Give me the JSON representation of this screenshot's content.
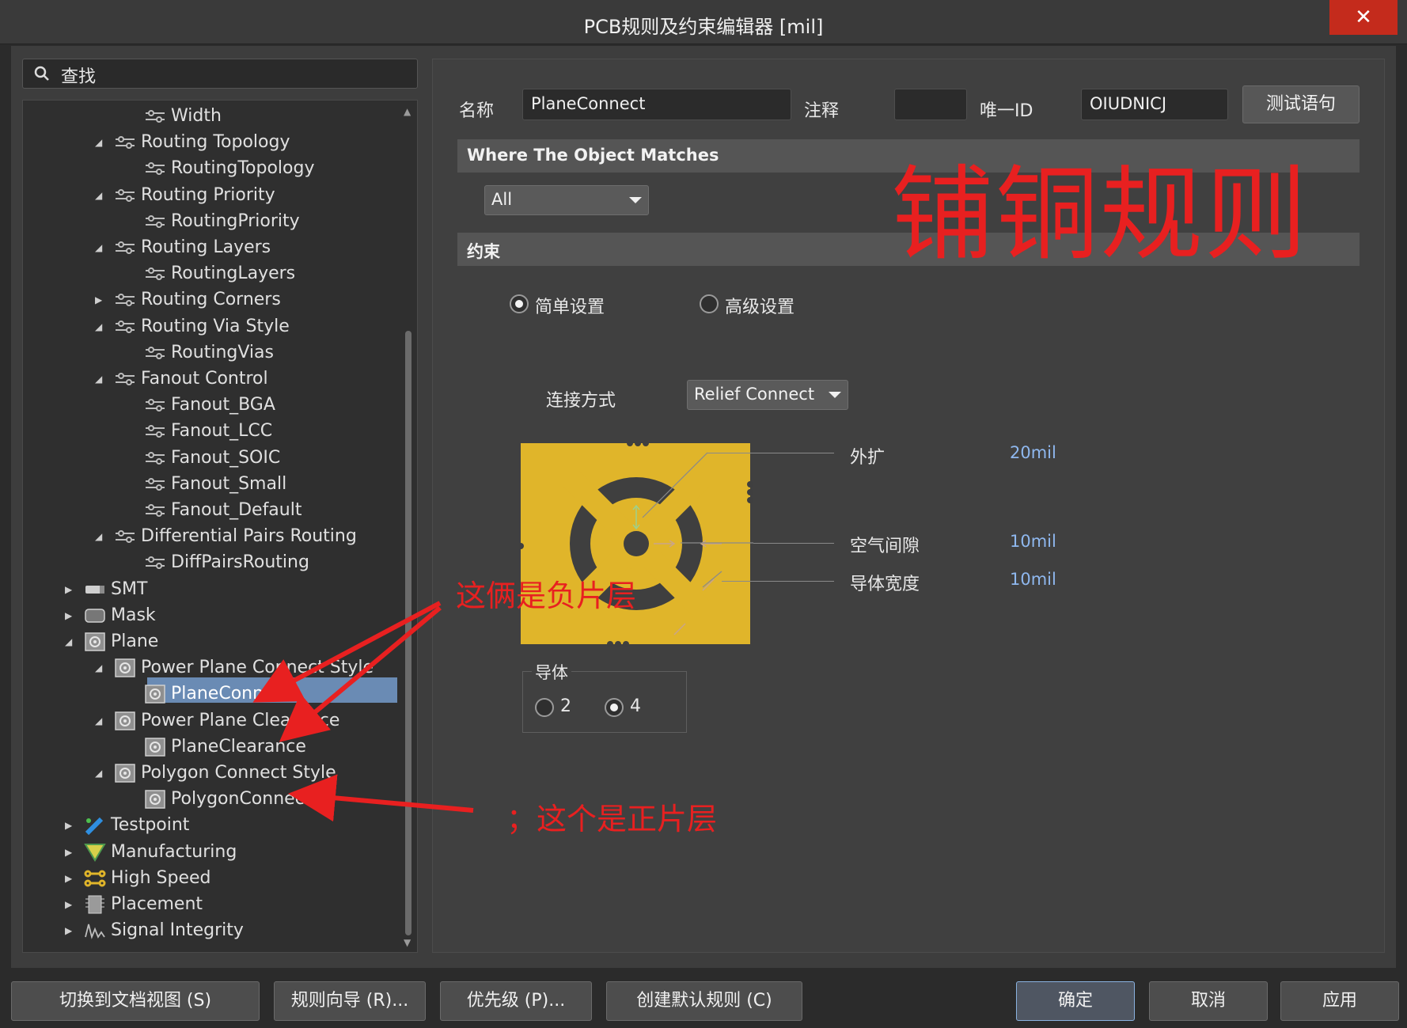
{
  "window": {
    "title": "PCB规则及约束编辑器 [mil]",
    "close_glyph": "✕"
  },
  "search": {
    "placeholder": "查找"
  },
  "tree": [
    {
      "label": "Width",
      "level": 2,
      "icon": "rule-icon"
    },
    {
      "label": "Routing Topology",
      "level": 1,
      "icon": "rule-icon",
      "arrow": "expanded"
    },
    {
      "label": "RoutingTopology",
      "level": 2,
      "icon": "rule-icon"
    },
    {
      "label": "Routing Priority",
      "level": 1,
      "icon": "rule-icon",
      "arrow": "expanded"
    },
    {
      "label": "RoutingPriority",
      "level": 2,
      "icon": "rule-icon"
    },
    {
      "label": "Routing Layers",
      "level": 1,
      "icon": "rule-icon",
      "arrow": "expanded"
    },
    {
      "label": "RoutingLayers",
      "level": 2,
      "icon": "rule-icon"
    },
    {
      "label": "Routing Corners",
      "level": 1,
      "icon": "rule-icon",
      "arrow": "collapsed"
    },
    {
      "label": "Routing Via Style",
      "level": 1,
      "icon": "rule-icon",
      "arrow": "expanded"
    },
    {
      "label": "RoutingVias",
      "level": 2,
      "icon": "rule-icon"
    },
    {
      "label": "Fanout Control",
      "level": 1,
      "icon": "rule-icon",
      "arrow": "expanded"
    },
    {
      "label": "Fanout_BGA",
      "level": 2,
      "icon": "rule-icon"
    },
    {
      "label": "Fanout_LCC",
      "level": 2,
      "icon": "rule-icon"
    },
    {
      "label": "Fanout_SOIC",
      "level": 2,
      "icon": "rule-icon"
    },
    {
      "label": "Fanout_Small",
      "level": 2,
      "icon": "rule-icon"
    },
    {
      "label": "Fanout_Default",
      "level": 2,
      "icon": "rule-icon"
    },
    {
      "label": "Differential Pairs Routing",
      "level": 1,
      "icon": "rule-icon",
      "arrow": "expanded"
    },
    {
      "label": "DiffPairsRouting",
      "level": 2,
      "icon": "rule-icon"
    },
    {
      "label": "SMT",
      "level": 0,
      "icon": "smt-icon",
      "arrow": "collapsed"
    },
    {
      "label": "Mask",
      "level": 0,
      "icon": "mask-icon",
      "arrow": "collapsed"
    },
    {
      "label": "Plane",
      "level": 0,
      "icon": "plane-icon",
      "arrow": "expanded"
    },
    {
      "label": "Power Plane Connect Style",
      "level": 1,
      "icon": "plane-icon",
      "arrow": "expanded"
    },
    {
      "label": "PlaneConnect",
      "level": 2,
      "icon": "plane-icon",
      "selected": true
    },
    {
      "label": "Power Plane Clearance",
      "level": 1,
      "icon": "plane-icon",
      "arrow": "expanded"
    },
    {
      "label": "PlaneClearance",
      "level": 2,
      "icon": "plane-icon"
    },
    {
      "label": "Polygon Connect Style",
      "level": 1,
      "icon": "plane-icon",
      "arrow": "expanded"
    },
    {
      "label": "PolygonConnect",
      "level": 2,
      "icon": "plane-icon"
    },
    {
      "label": "Testpoint",
      "level": 0,
      "icon": "testpoint-icon",
      "arrow": "collapsed"
    },
    {
      "label": "Manufacturing",
      "level": 0,
      "icon": "manufacturing-icon",
      "arrow": "collapsed"
    },
    {
      "label": "High Speed",
      "level": 0,
      "icon": "high-speed-icon",
      "arrow": "collapsed"
    },
    {
      "label": "Placement",
      "level": 0,
      "icon": "placement-icon",
      "arrow": "collapsed"
    },
    {
      "label": "Signal Integrity",
      "level": 0,
      "icon": "signal-integrity-icon",
      "arrow": "collapsed"
    }
  ],
  "rule": {
    "name_label": "名称",
    "name_value": "PlaneConnect",
    "comment_label": "注释",
    "comment_value": "",
    "uid_label": "唯一ID",
    "uid_value": "OIUDNICJ",
    "test_button": "测试语句"
  },
  "where": {
    "title": "Where The Object Matches",
    "scope_value": "All"
  },
  "constraints": {
    "title": "约束",
    "mode_simple": "简单设置",
    "mode_advanced": "高级设置",
    "mode_selected": "simple",
    "connect_label": "连接方式",
    "connect_value": "Relief Connect",
    "params": [
      {
        "label": "外扩",
        "value": "20mil"
      },
      {
        "label": "空气间隙",
        "value": "10mil"
      },
      {
        "label": "导体宽度",
        "value": "10mil"
      }
    ],
    "conductors_title": "导体",
    "conductor_options": [
      "2",
      "4"
    ],
    "conductor_selected": "4"
  },
  "annotations": {
    "watermark": "铺铜规则",
    "negative_note": "这俩是负片层",
    "positive_note": "；这个是正片层"
  },
  "footer": {
    "switch_view": "切换到文档视图 (S)",
    "wizard": "规则向导 (R)...",
    "priority": "优先级 (P)...",
    "create_default": "创建默认规则 (C)",
    "ok": "确定",
    "cancel": "取消",
    "apply": "应用"
  },
  "colors": {
    "thermal_pad": "#e0b52a",
    "annotation": "#e82020",
    "selection": "#6a8bb4",
    "value_text": "#8fb8ef"
  }
}
